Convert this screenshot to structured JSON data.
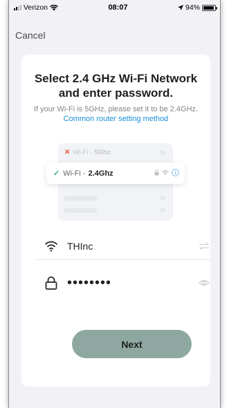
{
  "status_bar": {
    "carrier": "Verizon",
    "time": "08:07",
    "battery": "94%",
    "battery_level": 0.94
  },
  "nav": {
    "cancel_label": "Cancel"
  },
  "header": {
    "title_line1": "Select 2.4 GHz Wi-Fi Network",
    "title_line2": "and enter password.",
    "subtitle": "If your Wi-Fi is 5GHz, please set it to be 2.4GHz.",
    "subtitle_link": "Common router setting method"
  },
  "illustration": {
    "row1_prefix": "Wi-Fi -",
    "row1_band": "5Ghz",
    "row2_prefix": "Wi-Fi -",
    "row2_band": "2.4Ghz"
  },
  "form": {
    "ssid_value": "THInc",
    "password_value": "••••••••"
  },
  "actions": {
    "next_label": "Next"
  },
  "colors": {
    "accent_link": "#1a8fd9",
    "next_button": "#8ea8a1",
    "check_green": "#3cb46e",
    "x_red": "#e8533f"
  }
}
